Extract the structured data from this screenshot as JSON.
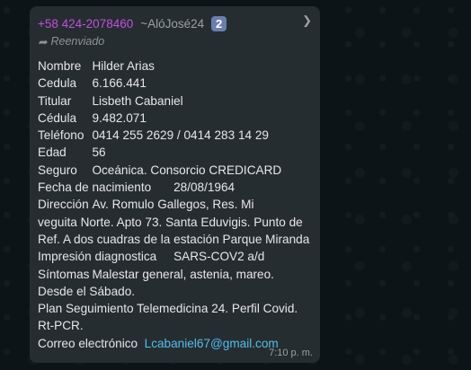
{
  "message": {
    "sender_phone": "+58 424-2078460",
    "sender_alias": "~AlóJosé24",
    "badge": "2",
    "forwarded_label": "Reenviado",
    "lines": [
      "Nombre\tHilder Arias",
      "Cedula\t6.166.441",
      "Titular\tLisbeth Cabaniel",
      "Cédula\t9.482.071",
      "Teléfono\t0414 255 2629 / 0414 283 14 29",
      "Edad\t56",
      "Seguro\tOceánica. Consorcio CREDICARD",
      "Fecha de nacimiento\t28/08/1964",
      "Dirección\tAv. Romulo Gallegos, Res. Mi",
      "veguita Norte. Apto 73. Santa Eduvigis. Punto de",
      "Ref. A dos cuadras de la estación Parque Miranda",
      "Impresión diagnostica\tSARS-COV2 a/d",
      "Síntomas\tMalestar general, astenia, mareo.",
      "Desde el Sábado.",
      "Plan Seguimiento Telemedicina 24. Perfil Covid.",
      "Rt-PCR."
    ],
    "email_label": "Correo electrónico",
    "email": "Lcabaniel67@gmail.com",
    "time": "7:10 p. m."
  }
}
